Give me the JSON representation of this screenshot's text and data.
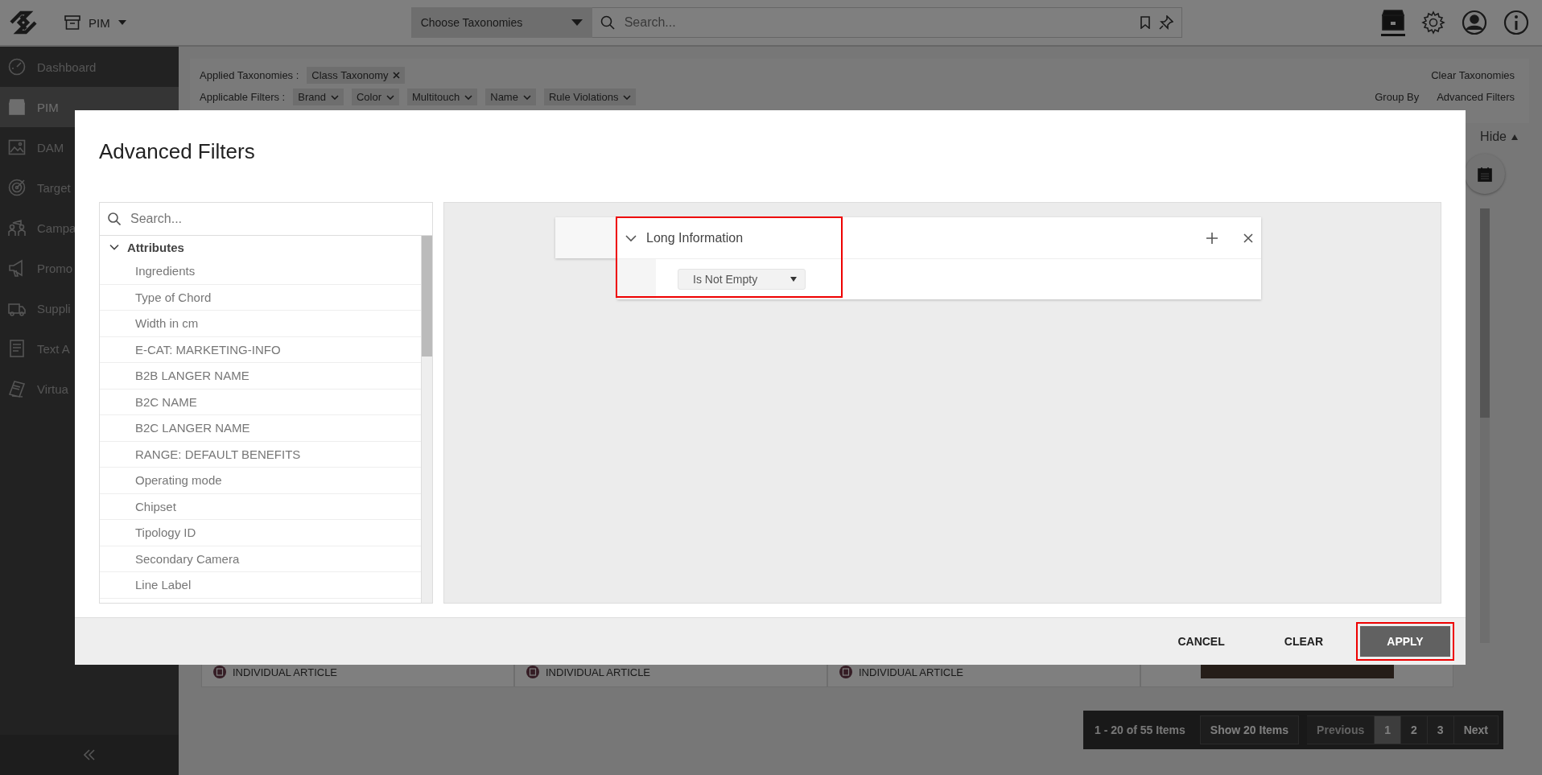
{
  "app_bar": {
    "module": "PIM",
    "taxonomy_select": "Choose Taxonomies",
    "search": {
      "placeholder": "Search..."
    }
  },
  "sidebar": {
    "items": [
      {
        "label": "Dashboard",
        "selected": false
      },
      {
        "label": "PIM",
        "selected": true
      },
      {
        "label": "DAM",
        "selected": false
      },
      {
        "label": "Target",
        "selected": false
      },
      {
        "label": "Campa",
        "selected": false
      },
      {
        "label": "Promo",
        "selected": false
      },
      {
        "label": "Suppli",
        "selected": false
      },
      {
        "label": "Text A",
        "selected": false
      },
      {
        "label": "Virtua",
        "selected": false
      }
    ]
  },
  "filters": {
    "applied_label": "Applied Taxonomies :",
    "applied": [
      "Class Taxonomy"
    ],
    "applicable_label": "Applicable Filters :",
    "applicable": [
      "Brand",
      "Color",
      "Multitouch",
      "Name",
      "Rule Violations"
    ],
    "clear": "Clear Taxonomies",
    "group_by": "Group By",
    "advanced": "Advanced Filters",
    "hide": "Hide"
  },
  "cards": [
    {
      "type_label": "INDIVIDUAL ARTICLE"
    },
    {
      "type_label": "INDIVIDUAL ARTICLE"
    },
    {
      "type_label": "INDIVIDUAL ARTICLE"
    }
  ],
  "pagination": {
    "summary": "1 - 20 of 55 Items",
    "page_size": "Show 20 Items",
    "previous": "Previous",
    "previous_disabled": true,
    "pages": [
      {
        "label": "1",
        "selected": true
      },
      {
        "label": "2",
        "selected": false
      },
      {
        "label": "3",
        "selected": false
      }
    ],
    "next": "Next"
  },
  "dialog": {
    "title": "Advanced Filters",
    "search": {
      "placeholder": "Search..."
    },
    "tree": [
      {
        "label": "Attributes",
        "expanded": true,
        "children": [
          {
            "label": "Ingredients"
          },
          {
            "label": "Type of Chord"
          },
          {
            "label": "Width in cm"
          },
          {
            "label": "E-CAT: MARKETING-INFO"
          },
          {
            "label": "B2B LANGER NAME"
          },
          {
            "label": "B2C NAME"
          },
          {
            "label": "B2C LANGER NAME"
          },
          {
            "label": "RANGE: DEFAULT BENEFITS"
          },
          {
            "label": "Operating mode"
          },
          {
            "label": "Chipset"
          },
          {
            "label": "Tipology ID"
          },
          {
            "label": "Secondary Camera"
          },
          {
            "label": "Line Label"
          }
        ]
      }
    ],
    "rules": [
      {
        "field": "Long Information",
        "expanded": true,
        "operator": "Is Not Empty",
        "highlighted": true
      }
    ],
    "buttons": [
      {
        "label": "CANCEL",
        "kind": "text",
        "highlighted": false
      },
      {
        "label": "CLEAR",
        "kind": "text",
        "highlighted": false
      },
      {
        "label": "APPLY",
        "kind": "primary",
        "highlighted": true
      }
    ]
  }
}
